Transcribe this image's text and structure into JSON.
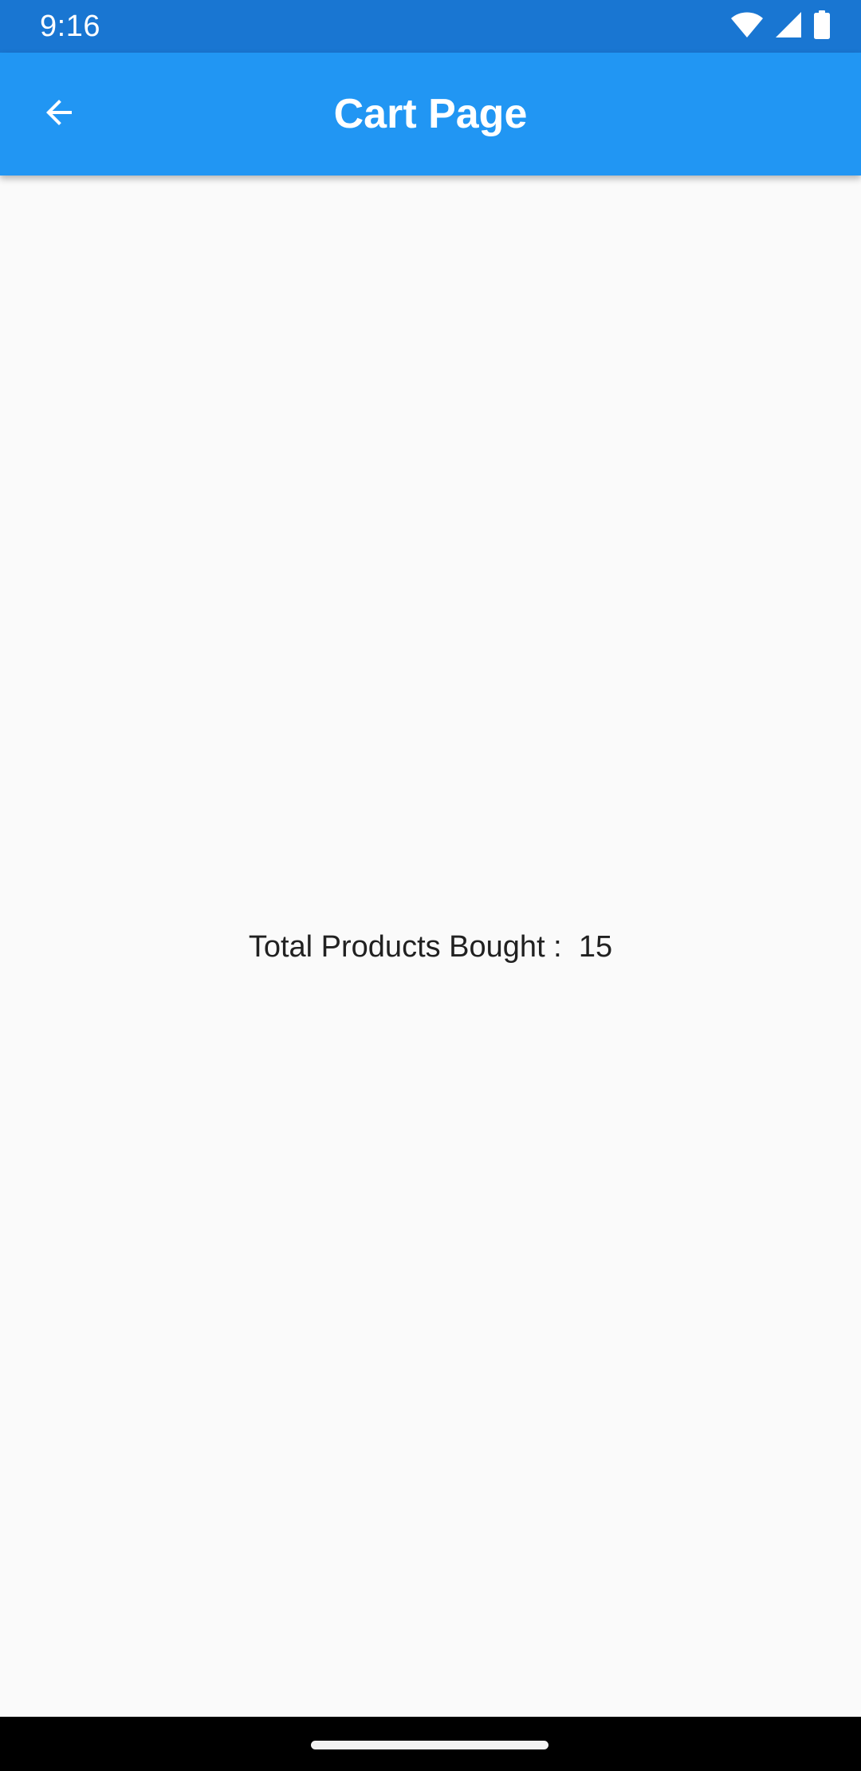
{
  "status_bar": {
    "time": "9:16",
    "icons": [
      "wifi-icon",
      "signal-icon",
      "battery-icon"
    ]
  },
  "app_bar": {
    "title": "Cart Page",
    "back_icon": "arrow-back-icon"
  },
  "content": {
    "total_label": "Total Products Bought :",
    "total_value": "15"
  },
  "nav_bar": {
    "handle": "home-gesture-handle"
  },
  "colors": {
    "status_bar": "#1976d2",
    "app_bar": "#2196f3",
    "background": "#fafafa",
    "text": "#212121",
    "nav_bar": "#000000"
  }
}
